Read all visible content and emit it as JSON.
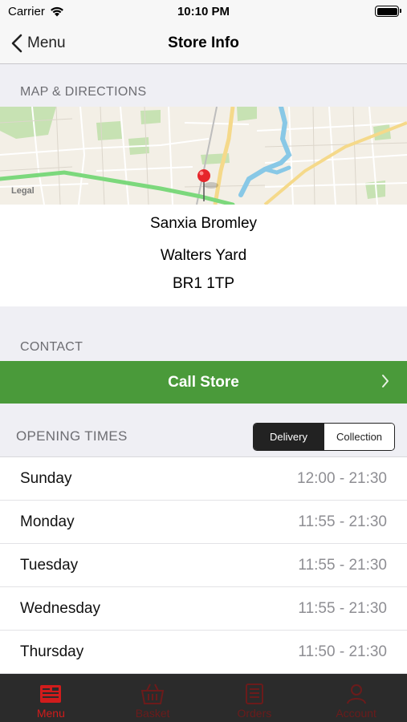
{
  "status_bar": {
    "carrier": "Carrier",
    "time": "10:10 PM"
  },
  "nav": {
    "back_label": "Menu",
    "title": "Store Info"
  },
  "map_section": {
    "header": "MAP & DIRECTIONS",
    "legal": "Legal"
  },
  "address": {
    "name": "Sanxia Bromley",
    "street": "Walters Yard",
    "postcode": "BR1 1TP"
  },
  "contact": {
    "header": "CONTACT",
    "call_label": "Call Store"
  },
  "opening_times": {
    "header": "OPENING TIMES",
    "segments": [
      "Delivery",
      "Collection"
    ],
    "selected": "Delivery",
    "rows": [
      {
        "day": "Sunday",
        "hours": "12:00 - 21:30"
      },
      {
        "day": "Monday",
        "hours": "11:55 - 21:30"
      },
      {
        "day": "Tuesday",
        "hours": "11:55 - 21:30"
      },
      {
        "day": "Wednesday",
        "hours": "11:55 - 21:30"
      },
      {
        "day": "Thursday",
        "hours": "11:50 - 21:30"
      }
    ]
  },
  "tab_bar": {
    "tabs": [
      {
        "label": "Menu",
        "icon": "menu-board-icon",
        "active": true
      },
      {
        "label": "Basket",
        "icon": "basket-icon",
        "active": false
      },
      {
        "label": "Orders",
        "icon": "orders-icon",
        "active": false
      },
      {
        "label": "Account",
        "icon": "account-icon",
        "active": false
      }
    ]
  },
  "colors": {
    "accent_green": "#4a9a3a",
    "tab_active": "#d01c1c",
    "tab_inactive": "#6b1b1b",
    "tab_bar_bg": "#2b2b2b"
  }
}
